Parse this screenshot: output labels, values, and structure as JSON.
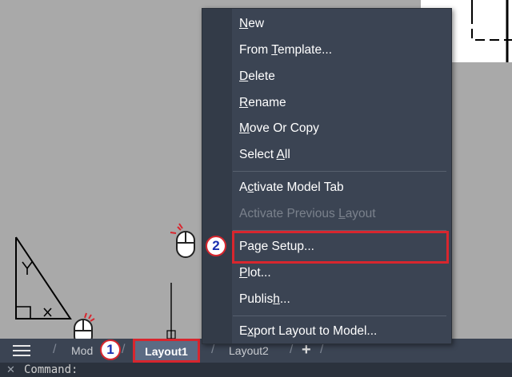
{
  "menu": {
    "items": [
      {
        "pre": "",
        "ul": "N",
        "post": "ew"
      },
      {
        "pre": "From ",
        "ul": "T",
        "post": "emplate..."
      },
      {
        "pre": "",
        "ul": "D",
        "post": "elete"
      },
      {
        "pre": "",
        "ul": "R",
        "post": "ename"
      },
      {
        "pre": "",
        "ul": "M",
        "post": "ove Or Copy"
      },
      {
        "pre": "Select ",
        "ul": "A",
        "post": "ll"
      },
      {
        "pre": "A",
        "ul": "c",
        "post": "tivate Model Tab"
      },
      {
        "pre": "Activate Previous ",
        "ul": "L",
        "post": "ayout"
      },
      {
        "pre": "Pa",
        "ul": "g",
        "post": "e Setup..."
      },
      {
        "pre": "",
        "ul": "P",
        "post": "lot..."
      },
      {
        "pre": "Publis",
        "ul": "h",
        "post": "..."
      },
      {
        "pre": "E",
        "ul": "x",
        "post": "port Layout to Model..."
      }
    ]
  },
  "tabs": {
    "model": "Mod",
    "layout1": "Layout1",
    "layout2": "Layout2",
    "sep": "/",
    "plus": "+"
  },
  "command": {
    "close": "✕",
    "text": "Command:"
  },
  "callouts": {
    "step1": "1",
    "step2": "2"
  },
  "colors": {
    "menu_bg": "#3b4453",
    "highlight": "#d8262e",
    "badge_text": "#1a2fb0",
    "canvas": "#a9a9a9"
  }
}
